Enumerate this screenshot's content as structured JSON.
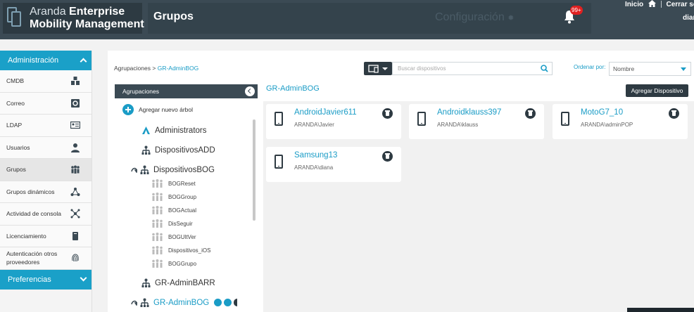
{
  "header": {
    "logo_brand": "Aranda",
    "logo_bold": "Enterprise",
    "logo_line2": "Mobility Management",
    "page_title": "Grupos",
    "config_label": "Configuración",
    "notification_count": "99+",
    "home_link": "Inicio",
    "logout_link": "Cerrar sesi",
    "user_name": "diar"
  },
  "sidebar": {
    "admin_section": "Administración",
    "items": [
      {
        "label": "CMDB",
        "icon": "cmdb-icon"
      },
      {
        "label": "Correo",
        "icon": "mail-icon"
      },
      {
        "label": "LDAP",
        "icon": "id-card-icon"
      },
      {
        "label": "Usuarios",
        "icon": "user-icon"
      },
      {
        "label": "Grupos",
        "icon": "users-group-icon",
        "active": true
      },
      {
        "label": "Grupos dinámicos",
        "icon": "dynamic-groups-icon"
      },
      {
        "label": "Actividad de consola",
        "icon": "activity-icon"
      },
      {
        "label": "Licenciamiento",
        "icon": "license-icon"
      },
      {
        "label": "Autenticación otros proveedores",
        "icon": "fingerprint-icon"
      }
    ],
    "prefs_section": "Preferencias"
  },
  "toolbar": {
    "breadcrumb_root": "Agrupaciones",
    "breadcrumb_sep": ">",
    "breadcrumb_current": "GR-AdminBOG",
    "search_placeholder": "Buscar dispositivos",
    "order_label": "Ordenar por:",
    "order_value": "Nombre"
  },
  "tree": {
    "header": "Agrupaciones",
    "add_label": "Agregar nuevo árbol",
    "nodes": [
      {
        "label": "Administrators"
      },
      {
        "label": "DispositivosADD"
      },
      {
        "label": "DispositivosBOG"
      },
      {
        "label": "GR-AdminBARR"
      },
      {
        "label": "GR-AdminBOG"
      }
    ],
    "children": [
      "BOGReset",
      "BOGGroup",
      "BOGActual",
      "DisSeguir",
      "BOGUltVer",
      "Dispositivos_iOS",
      "BOGGrupo"
    ]
  },
  "devices": {
    "group_title": "GR-AdminBOG",
    "add_button": "Agregar Dispositivo",
    "items": [
      {
        "name": "AndroidJavier611",
        "user": "ARANDA\\Javier"
      },
      {
        "name": "Androidklauss397",
        "user": "ARANDA\\klauss"
      },
      {
        "name": "MotoG7_10",
        "user": "ARANDA\\adminPOP"
      },
      {
        "name": "Samsung13",
        "user": "ARANDA\\diana"
      }
    ]
  },
  "colors": {
    "header_bg": "#3b4a54",
    "accent": "#1a9cc6",
    "dark_button": "#2e3a42",
    "badge": "#e02020"
  }
}
